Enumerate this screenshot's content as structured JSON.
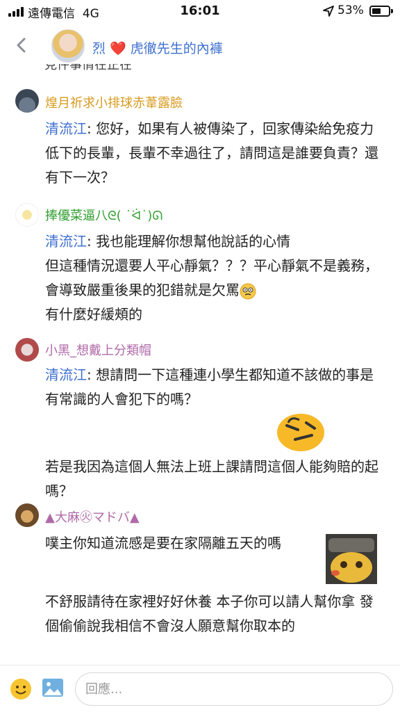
{
  "status_bar": {
    "carrier": "遠傳電信",
    "network": "4G",
    "time": "16:01",
    "battery_percent": "53%",
    "battery_level": 0.53
  },
  "header": {
    "title_prefix": "烈",
    "heart": "❤️",
    "title_suffix": "虎徹先生的內褲"
  },
  "clipped_line": "見件事情在正在",
  "messages": [
    {
      "username": "煌月祈求小排球赤葦露臉",
      "username_color": "#d79a1e",
      "quote_name": "清流江",
      "body": ": 您好，如果有人被傳染了，回家傳染給免疫力低下的長輩，長輩不幸過往了，請問這是誰要負責？還有下一次？"
    },
    {
      "username": "捧優菜逼八ᘓ( ˙ᐛ˙)ᘏ",
      "username_color": "#2f9e2f",
      "quote_name": "清流江",
      "line1": ": 我也能理解你想幫他說話的心情",
      "line2": "但這種情況還要人平心靜氣？？？平心靜氣不是義務，會導致嚴重後果的犯錯就是欠罵",
      "line3": "有什麼好緩頰的"
    },
    {
      "username": "小黑_想戴上分類帽",
      "username_color": "#b06aa8",
      "quote_name": "清流江",
      "line1": ": 想請問一下這種連小學生都知道不該做的事是有常識的人會犯下的嗎？",
      "line2": "若是我因為這個人無法上班上課請問這個人能夠賠的起嗎？"
    },
    {
      "username": "▲大麻㊋マドバ▲",
      "username_color": "#b06aa8",
      "line1": "噗主你知道流感是要在家隔離五天的嗎",
      "line2": "不舒服請待在家裡好好休養 本子你可以請人幫你拿 發個偷偷說我相信不會沒人願意幫你取本的"
    }
  ],
  "composer": {
    "placeholder": "回應..."
  },
  "icons": [
    "back-chevron-icon",
    "location-arrow-icon",
    "battery-icon",
    "emoji-icon",
    "image-icon"
  ]
}
